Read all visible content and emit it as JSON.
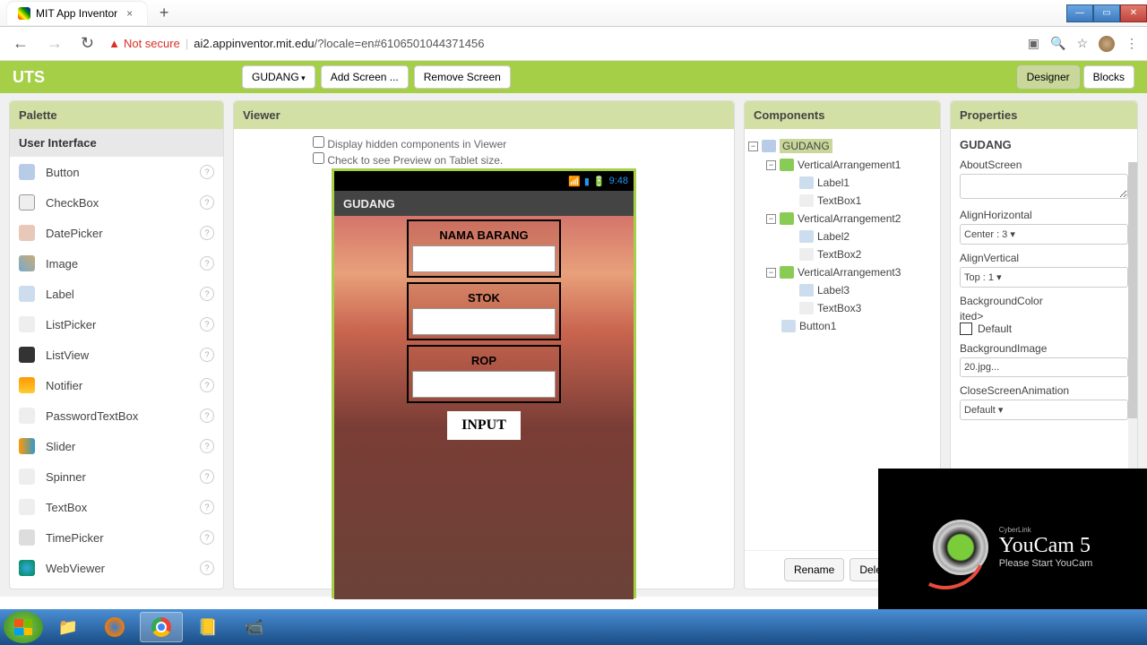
{
  "browser": {
    "tab_title": "MIT App Inventor",
    "not_secure": "Not secure",
    "url_host": "ai2.appinventor.mit.edu",
    "url_path": "/?locale=en#6106501044371456"
  },
  "project": {
    "name": "UTS",
    "screen_selector": "GUDANG",
    "add_screen": "Add Screen ...",
    "remove_screen": "Remove Screen",
    "designer": "Designer",
    "blocks": "Blocks"
  },
  "palette": {
    "title": "Palette",
    "category": "User Interface",
    "items": [
      {
        "label": "Button",
        "icon": "ic-button"
      },
      {
        "label": "CheckBox",
        "icon": "ic-check"
      },
      {
        "label": "DatePicker",
        "icon": "ic-date"
      },
      {
        "label": "Image",
        "icon": "ic-image"
      },
      {
        "label": "Label",
        "icon": "ic-label"
      },
      {
        "label": "ListPicker",
        "icon": "ic-list"
      },
      {
        "label": "ListView",
        "icon": "ic-listview"
      },
      {
        "label": "Notifier",
        "icon": "ic-notif"
      },
      {
        "label": "PasswordTextBox",
        "icon": "ic-pwd"
      },
      {
        "label": "Slider",
        "icon": "ic-slider"
      },
      {
        "label": "Spinner",
        "icon": "ic-spinner"
      },
      {
        "label": "TextBox",
        "icon": "ic-textbox"
      },
      {
        "label": "TimePicker",
        "icon": "ic-timepicker"
      },
      {
        "label": "WebViewer",
        "icon": "ic-webview"
      }
    ]
  },
  "viewer": {
    "title": "Viewer",
    "check1": "Display hidden components in Viewer",
    "check2": "Check to see Preview on Tablet size.",
    "phone": {
      "time": "9:48",
      "title": "GUDANG",
      "field1": "NAMA BARANG",
      "field2": "STOK",
      "field3": "ROP",
      "button": "INPUT"
    }
  },
  "components": {
    "title": "Components",
    "rename": "Rename",
    "delete": "Delete",
    "tree": {
      "root": "GUDANG",
      "va1": "VerticalArrangement1",
      "l1": "Label1",
      "tb1": "TextBox1",
      "va2": "VerticalArrangement2",
      "l2": "Label2",
      "tb2": "TextBox2",
      "va3": "VerticalArrangement3",
      "l3": "Label3",
      "tb3": "TextBox3",
      "btn1": "Button1"
    }
  },
  "properties": {
    "title": "Properties",
    "target": "GUDANG",
    "about_screen": "AboutScreen",
    "align_h": "AlignHorizontal",
    "align_h_val": "Center : 3",
    "align_v": "AlignVertical",
    "align_v_val": "Top : 1",
    "bg_color": "BackgroundColor",
    "bg_color_val": "Default",
    "bg_image": "BackgroundImage",
    "bg_image_val": "20.jpg...",
    "close_anim": "CloseScreenAnimation",
    "close_anim_val": "Default"
  },
  "youcam": {
    "brand": "CyberLink",
    "title": "YouCam 5",
    "subtitle": "Please Start YouCam"
  }
}
